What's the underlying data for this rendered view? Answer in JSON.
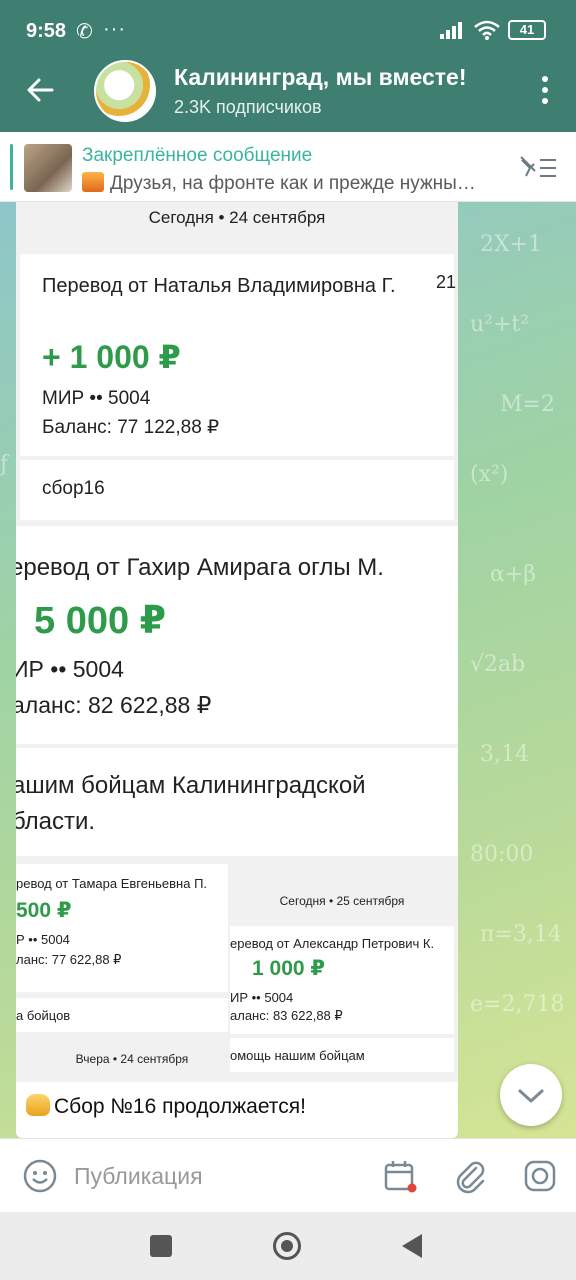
{
  "status_bar": {
    "time": "9:58",
    "battery": "41"
  },
  "header": {
    "title": "Калининград, мы вместе!",
    "subscribers": "2.3K подписчиков"
  },
  "pinned": {
    "title": "Закреплённое сообщение",
    "text": "Друзья, на фронте как и прежде нужны…"
  },
  "post": {
    "screenshot": {
      "date1": "Сегодня • 24 сентября",
      "t1": {
        "name": "Перевод от Наталья Владимировна Г.",
        "time": "21",
        "amount": "+ 1 000 ₽",
        "card": "МИР •• 5004",
        "balance": "Баланс: 77 122,88 ₽",
        "comment": "сбор16"
      },
      "t2": {
        "name": "еревод от Гахир Амирага оглы М.",
        "amount": "5 000 ₽",
        "card": "ИР •• 5004",
        "balance": "аланс: 82 622,88 ₽",
        "comment": "ашим бойцам Калининградской бласти."
      },
      "t3": {
        "name": "ревод от Тамара Евгеньевна П.",
        "amount": "500 ₽",
        "card": "Р •• 5004",
        "balance": "ланс: 77 622,88 ₽",
        "comment": "а бойцов",
        "date": "Вчера • 24 сентября"
      },
      "t4": {
        "date": "Сегодня • 25 сентября",
        "name": "еревод от Александр Петрович К.",
        "amount": "1 000 ₽",
        "card": "ИР •• 5004",
        "balance": "аланс: 83 622,88 ₽",
        "comment": "омощь нашим бойцам"
      }
    },
    "caption": "Сбор №16 продолжается!"
  },
  "composer": {
    "placeholder": "Публикация"
  },
  "icons": {
    "back": "arrow-left-icon",
    "menu": "more-vert-icon",
    "pin": "unpin-list-icon",
    "scroll": "chevron-down-icon",
    "emoji": "emoji-icon",
    "schedule": "calendar-icon",
    "attach": "paperclip-icon",
    "camera": "instagram-camera-icon"
  },
  "colors": {
    "header": "#3f7f72",
    "accent": "#39b59f",
    "amount_green": "#2e9b4a"
  }
}
